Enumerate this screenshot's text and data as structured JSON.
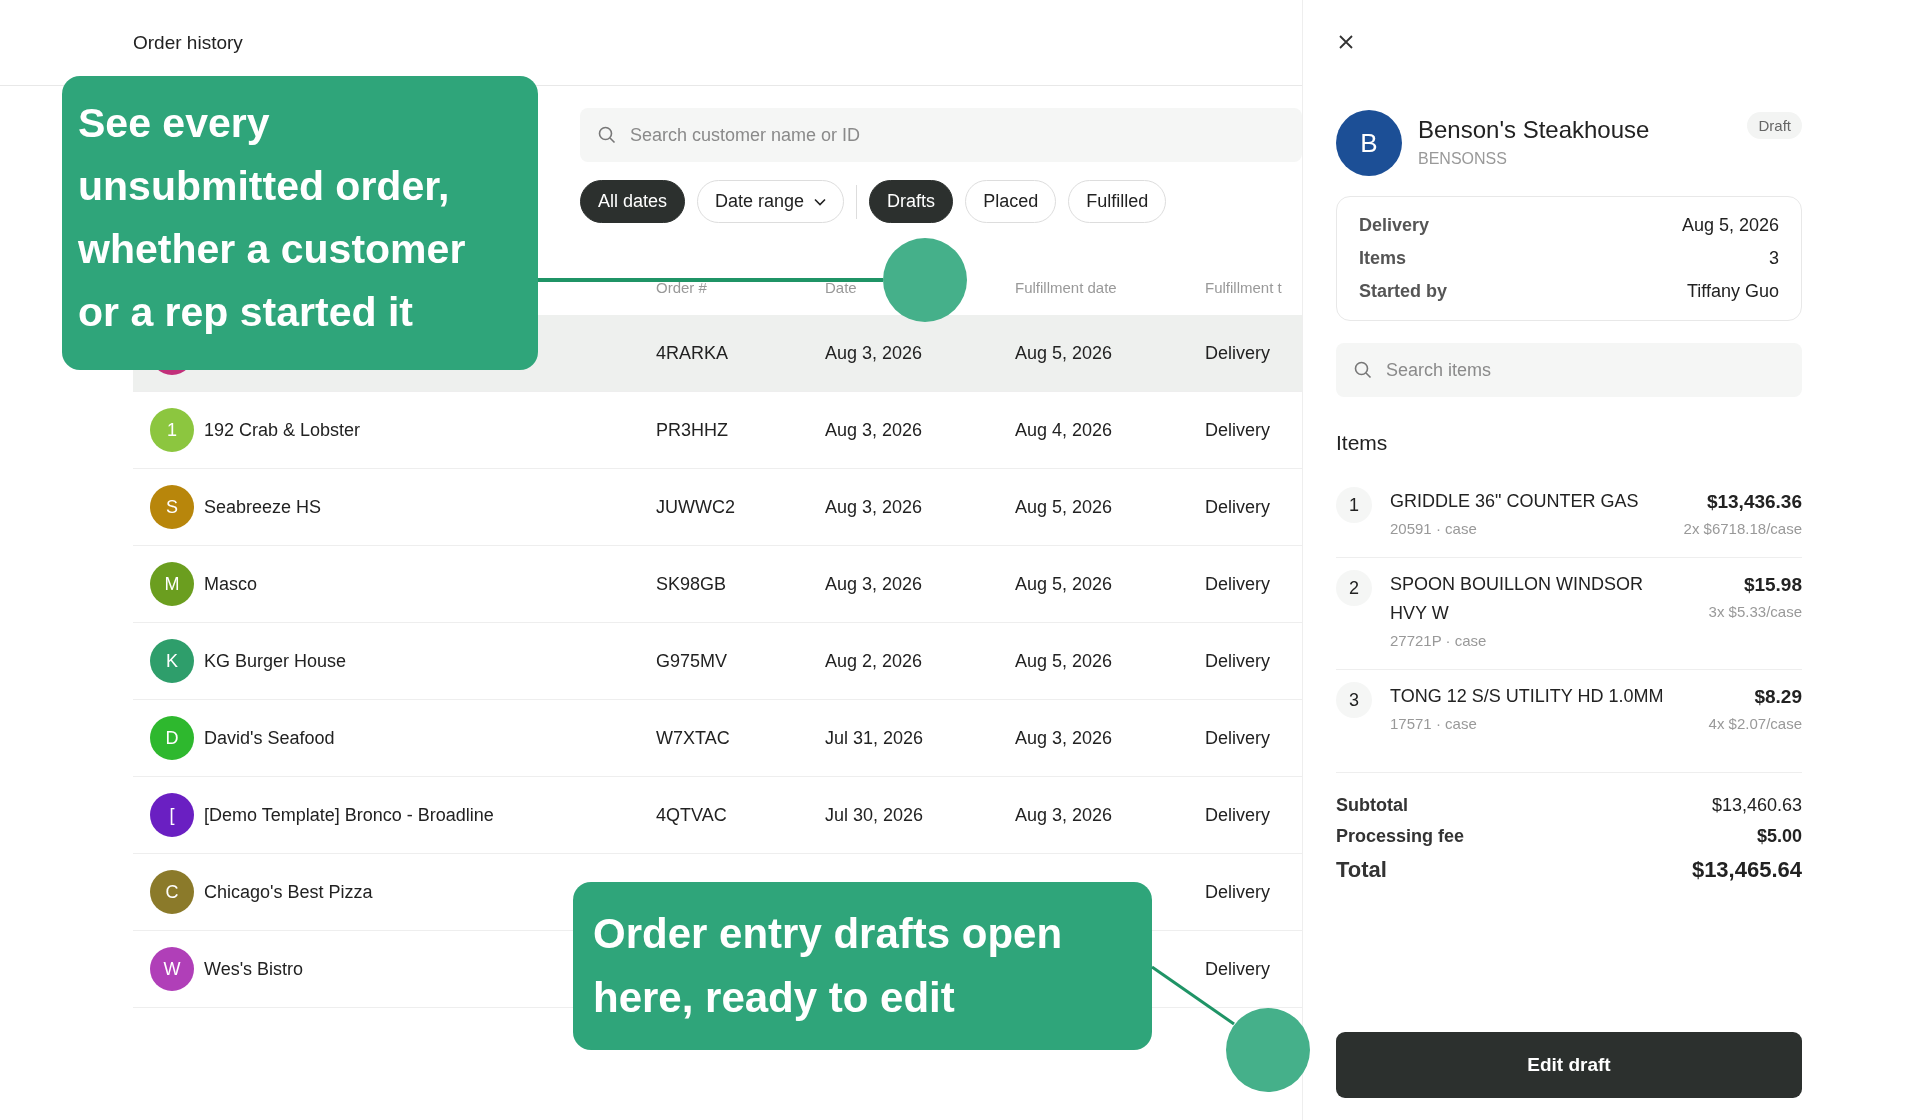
{
  "page_title": "Order history",
  "search": {
    "placeholder": "Search customer name or ID"
  },
  "date_filters": [
    {
      "label": "All dates",
      "kind": "chip",
      "selected": true
    },
    {
      "label": "Date range",
      "kind": "dropdown",
      "selected": false
    }
  ],
  "status_filters": [
    {
      "label": "Drafts",
      "selected": true
    },
    {
      "label": "Placed",
      "selected": false
    },
    {
      "label": "Fulfilled",
      "selected": false
    }
  ],
  "table": {
    "columns": [
      "Order #",
      "Date",
      "Fulfillment date",
      "Fulfillment t"
    ],
    "rows": [
      {
        "color": "#c2307a",
        "order": "4RARKA",
        "date": "Aug 3, 2026",
        "fulfillment_date": "Aug 5, 2026",
        "fulfillment_type": "Delivery",
        "selected": true
      },
      {
        "initial": "1",
        "color": "#8cc63f",
        "customer": "192 Crab & Lobster",
        "order": "PR3HHZ",
        "date": "Aug 3, 2026",
        "fulfillment_date": "Aug 4, 2026",
        "fulfillment_type": "Delivery",
        "selected": false
      },
      {
        "initial": "S",
        "color": "#b8860b",
        "customer": "Seabreeze HS",
        "order": "JUWWC2",
        "date": "Aug 3, 2026",
        "fulfillment_date": "Aug 5, 2026",
        "fulfillment_type": "Delivery",
        "selected": false
      },
      {
        "initial": "M",
        "color": "#6b9e1f",
        "customer": "Masco",
        "order": "SK98GB",
        "date": "Aug 3, 2026",
        "fulfillment_date": "Aug 5, 2026",
        "fulfillment_type": "Delivery",
        "selected": false
      },
      {
        "initial": "K",
        "color": "#2e9e6b",
        "customer": "KG Burger House",
        "order": "G975MV",
        "date": "Aug 2, 2026",
        "fulfillment_date": "Aug 5, 2026",
        "fulfillment_type": "Delivery",
        "selected": false
      },
      {
        "initial": "D",
        "color": "#2eb82e",
        "customer": "David's Seafood",
        "order": "W7XTAC",
        "date": "Jul 31, 2026",
        "fulfillment_date": "Aug 3, 2026",
        "fulfillment_type": "Delivery",
        "selected": false
      },
      {
        "initial": "[",
        "color": "#6a1fc2",
        "customer": "[Demo Template] Bronco - Broadline",
        "order": "4QTVAC",
        "date": "Jul 30, 2026",
        "fulfillment_date": "Aug 3, 2026",
        "fulfillment_type": "Delivery",
        "selected": false
      },
      {
        "initial": "C",
        "color": "#8b7a2a",
        "customer": "Chicago's Best Pizza",
        "fulfillment_type": "Delivery",
        "selected": false
      },
      {
        "initial": "W",
        "color": "#b03fb8",
        "customer": "Wes's Bistro",
        "fulfillment_type": "Delivery",
        "selected": false
      }
    ]
  },
  "callouts": [
    {
      "text": "See every unsubmitted order, whether a customer or a rep started it"
    },
    {
      "text": "Order entry drafts open here, ready to edit"
    }
  ],
  "drawer": {
    "customer": {
      "initial": "B",
      "name": "Benson's Steakhouse",
      "code": "BENSONSS",
      "status": "Draft"
    },
    "details": [
      {
        "label": "Delivery",
        "value": "Aug 5, 2026"
      },
      {
        "label": "Items",
        "value": "3"
      },
      {
        "label": "Started by",
        "value": "Tiffany Guo"
      }
    ],
    "search": {
      "placeholder": "Search items"
    },
    "items_heading": "Items",
    "items": [
      {
        "index": "1",
        "name": "GRIDDLE 36\" COUNTER GAS",
        "price": "$13,436.36",
        "meta": "20591 · case",
        "unit_price": "2x $6718.18/case"
      },
      {
        "index": "2",
        "name": "SPOON BOUILLON WINDSOR HVY W",
        "price": "$15.98",
        "meta": "27721P · case",
        "unit_price": "3x $5.33/case"
      },
      {
        "index": "3",
        "name": "TONG 12 S/S UTILITY HD 1.0MM",
        "price": "$8.29",
        "meta": "17571 · case",
        "unit_price": "4x $2.07/case"
      }
    ],
    "totals": [
      {
        "label": "Subtotal",
        "value": "$13,460.63",
        "kind": "subtotal"
      },
      {
        "label": "Processing fee",
        "value": "$5.00",
        "kind": "fee"
      },
      {
        "label": "Total",
        "value": "$13,465.64",
        "kind": "total"
      }
    ],
    "button": "Edit draft"
  }
}
